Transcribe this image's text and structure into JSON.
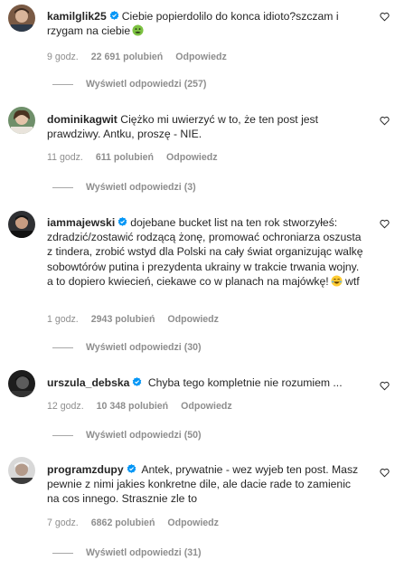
{
  "comments": [
    {
      "username": "kamilglik25",
      "verified": true,
      "text": "Ciebie popierdolilo do konca idioto?szczam i rzygam na ciebie",
      "emoji": "nauseated-face-icon",
      "time": "9 godz.",
      "likes": "22 691 polubień",
      "reply_label": "Odpowiedz",
      "view_replies": "Wyświetl odpowiedzi (257)"
    },
    {
      "username": "dominikagwit",
      "verified": false,
      "text": "Ciężko mi uwierzyć w to, że ten post jest prawdziwy. Antku, proszę - NIE.",
      "time": "11 godz.",
      "likes": "611 polubień",
      "reply_label": "Odpowiedz",
      "view_replies": "Wyświetl odpowiedzi (3)"
    },
    {
      "username": "iammajewski",
      "verified": true,
      "text": "dojebane bucket list na ten rok stworzyłeś: zdradzić/zostawić rodzącą żonę, promować ochroniarza oszusta z tindera, zrobić wstyd dla Polski na cały świat organizując walkę sobowtórów putina i prezydenta ukrainy w trakcie trwania wojny. a to dopiero kwiecień, ciekawe co w planach na majówkę!",
      "text_suffix": "wtf",
      "emoji": "tears-of-joy-icon",
      "time": "1 godz.",
      "likes": "2943 polubień",
      "reply_label": "Odpowiedz",
      "view_replies": "Wyświetl odpowiedzi (30)"
    },
    {
      "username": "urszula_debska",
      "verified": true,
      "text": "Chyba tego kompletnie nie rozumiem ...",
      "time": "12 godz.",
      "likes": "10 348 polubień",
      "reply_label": "Odpowiedz",
      "view_replies": "Wyświetl odpowiedzi (50)"
    },
    {
      "username": "programzdupy",
      "verified": true,
      "text": "Antek, prywatnie - wez wyjeb ten post. Masz pewnie z nimi jakies konkretne dile, ale dacie rade to zamienic na cos innego. Strasznie zle to",
      "time": "7 godz.",
      "likes": "6862 polubień",
      "reply_label": "Odpowiedz",
      "view_replies": "Wyświetl odpowiedzi (31)"
    }
  ],
  "colors": {
    "text": "#262626",
    "muted": "#8e8e8e",
    "verified": "#0095f6"
  }
}
